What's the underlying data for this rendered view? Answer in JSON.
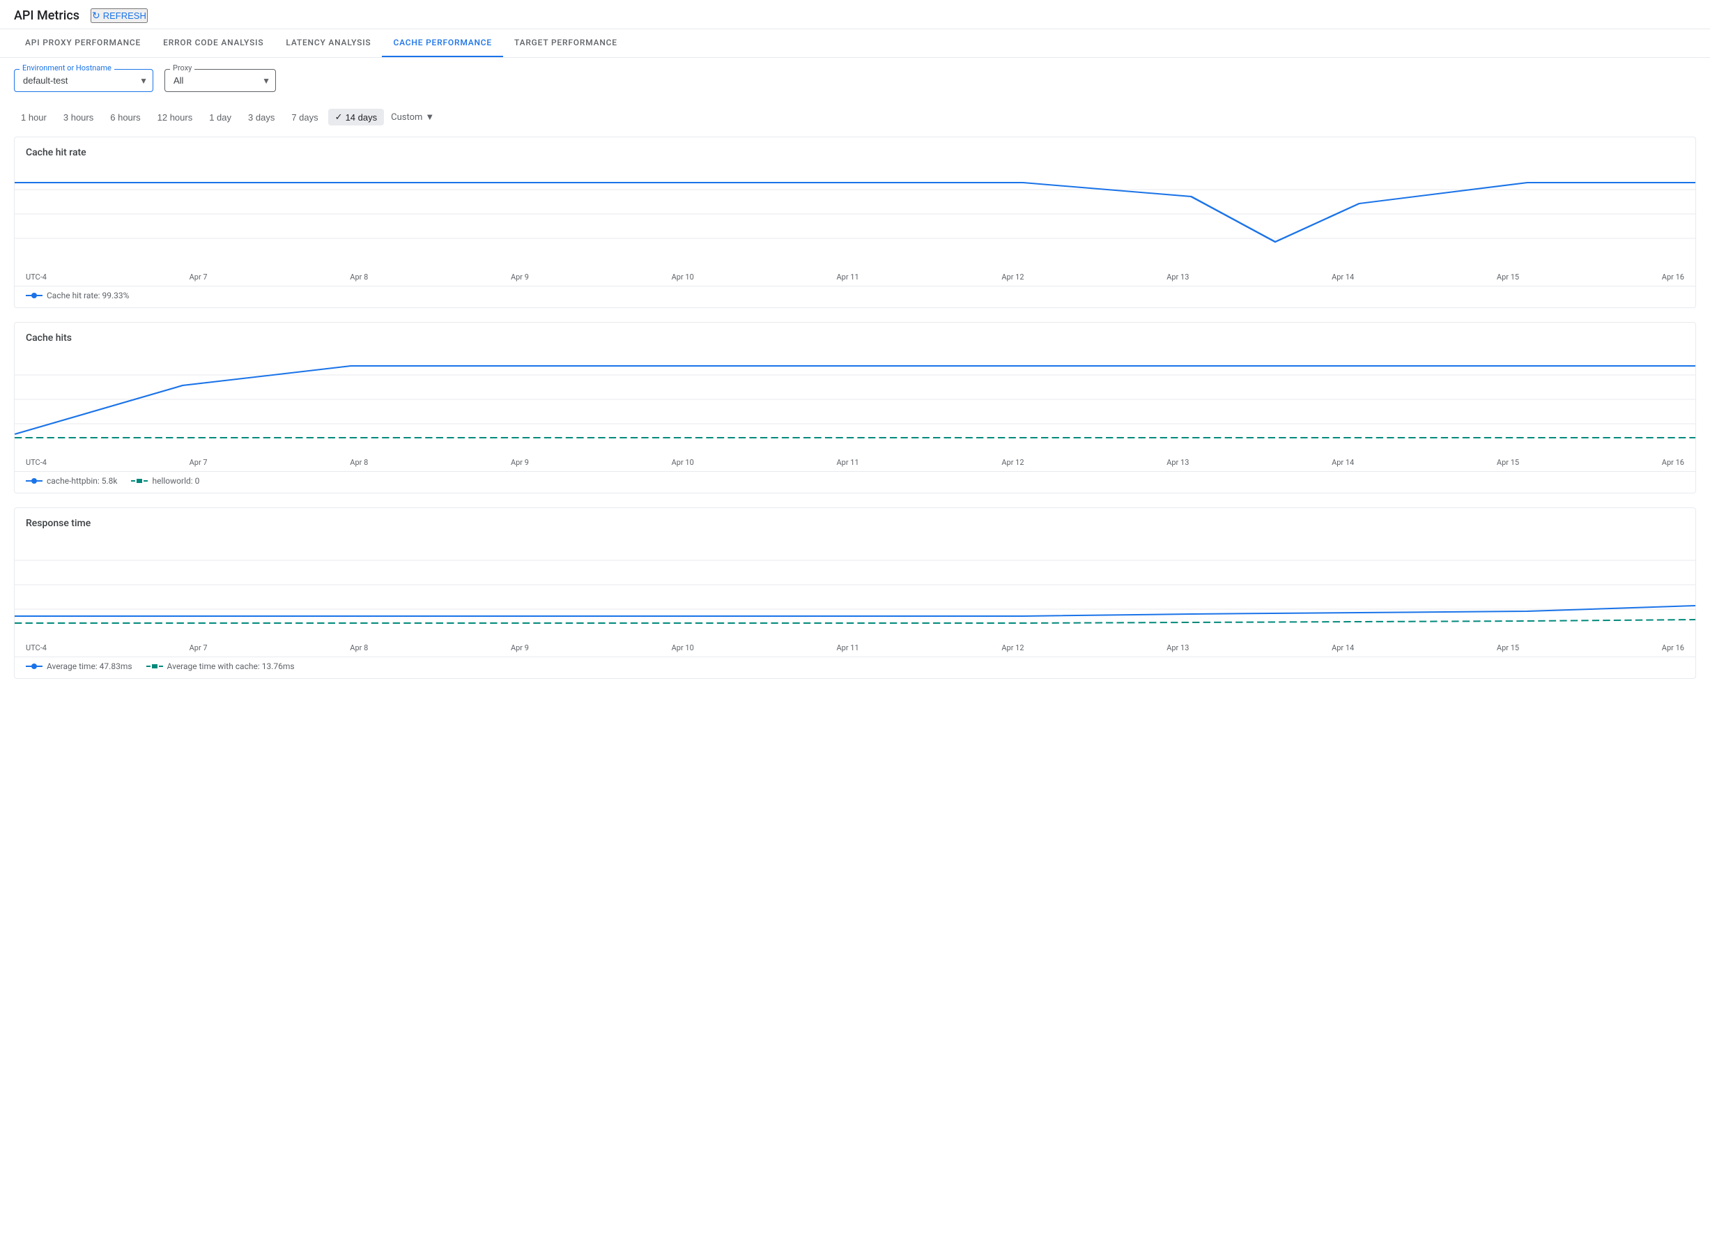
{
  "header": {
    "title": "API Metrics",
    "refresh_label": "REFRESH"
  },
  "tabs": [
    {
      "id": "api-proxy",
      "label": "API PROXY PERFORMANCE",
      "active": false
    },
    {
      "id": "error-code",
      "label": "ERROR CODE ANALYSIS",
      "active": false
    },
    {
      "id": "latency",
      "label": "LATENCY ANALYSIS",
      "active": false
    },
    {
      "id": "cache",
      "label": "CACHE PERFORMANCE",
      "active": true
    },
    {
      "id": "target",
      "label": "TARGET PERFORMANCE",
      "active": false
    }
  ],
  "filters": {
    "environment_label": "Environment or Hostname",
    "environment_value": "default-test",
    "proxy_label": "Proxy",
    "proxy_value": "All"
  },
  "time_filters": [
    {
      "id": "1h",
      "label": "1 hour",
      "active": false
    },
    {
      "id": "3h",
      "label": "3 hours",
      "active": false
    },
    {
      "id": "6h",
      "label": "6 hours",
      "active": false
    },
    {
      "id": "12h",
      "label": "12 hours",
      "active": false
    },
    {
      "id": "1d",
      "label": "1 day",
      "active": false
    },
    {
      "id": "3d",
      "label": "3 days",
      "active": false
    },
    {
      "id": "7d",
      "label": "7 days",
      "active": false
    },
    {
      "id": "14d",
      "label": "14 days",
      "active": true
    },
    {
      "id": "custom",
      "label": "Custom",
      "active": false
    }
  ],
  "charts": {
    "cache_hit_rate": {
      "title": "Cache hit rate",
      "x_labels": [
        "UTC-4",
        "Apr 7",
        "Apr 8",
        "Apr 9",
        "Apr 10",
        "Apr 11",
        "Apr 12",
        "Apr 13",
        "Apr 14",
        "Apr 15",
        "Apr 16"
      ],
      "legend": [
        {
          "label": "Cache hit rate: 99.33%",
          "color": "blue"
        }
      ]
    },
    "cache_hits": {
      "title": "Cache hits",
      "x_labels": [
        "UTC-4",
        "Apr 7",
        "Apr 8",
        "Apr 9",
        "Apr 10",
        "Apr 11",
        "Apr 12",
        "Apr 13",
        "Apr 14",
        "Apr 15",
        "Apr 16"
      ],
      "legend": [
        {
          "label": "cache-httpbin: 5.8k",
          "color": "blue"
        },
        {
          "label": "helloworld: 0",
          "color": "teal"
        }
      ]
    },
    "response_time": {
      "title": "Response time",
      "x_labels": [
        "UTC-4",
        "Apr 7",
        "Apr 8",
        "Apr 9",
        "Apr 10",
        "Apr 11",
        "Apr 12",
        "Apr 13",
        "Apr 14",
        "Apr 15",
        "Apr 16"
      ],
      "legend": [
        {
          "label": "Average time: 47.83ms",
          "color": "blue"
        },
        {
          "label": "Average time with cache: 13.76ms",
          "color": "teal"
        }
      ]
    }
  }
}
